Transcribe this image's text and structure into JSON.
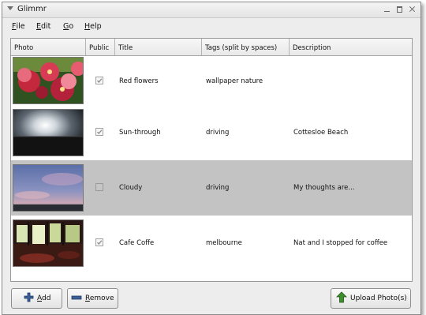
{
  "window": {
    "title": "Glimmr"
  },
  "menu": {
    "file": {
      "mnemonic": "F",
      "rest": "ile"
    },
    "edit": {
      "mnemonic": "E",
      "rest": "dit"
    },
    "go": {
      "mnemonic": "G",
      "rest": "o"
    },
    "help": {
      "mnemonic": "H",
      "rest": "elp"
    }
  },
  "table": {
    "columns": {
      "photo": "Photo",
      "public": "Public",
      "title": "Title",
      "tags": "Tags (split by spaces)",
      "description": "Description"
    },
    "rows": [
      {
        "public": true,
        "title": "Red flowers",
        "tags": "wallpaper nature",
        "description": "",
        "selected": false,
        "thumbnail": "red-flowers-photo"
      },
      {
        "public": true,
        "title": "Sun-through",
        "tags": "driving",
        "description": "Cottesloe Beach",
        "selected": false,
        "thumbnail": "sun-through-clouds-photo"
      },
      {
        "public": false,
        "title": "Cloudy",
        "tags": "driving",
        "description": "My thoughts are...",
        "selected": true,
        "thumbnail": "cloudy-sky-photo"
      },
      {
        "public": true,
        "title": "Cafe Coffe",
        "tags": "melbourne",
        "description": "Nat and I stopped for coffee",
        "selected": false,
        "thumbnail": "cafe-interior-photo"
      }
    ]
  },
  "buttons": {
    "add": {
      "mnemonic": "A",
      "rest": "dd",
      "icon": "plus-icon"
    },
    "remove": {
      "mnemonic": "R",
      "rest": "emove",
      "icon": "minus-icon"
    },
    "upload": {
      "label": "Upload Photo(s)",
      "icon": "upload-arrow-icon"
    }
  },
  "colors": {
    "selected_row": "#c3c3c3",
    "icon_green": "#3f8f2f",
    "icon_blue": "#3a5f9a"
  }
}
